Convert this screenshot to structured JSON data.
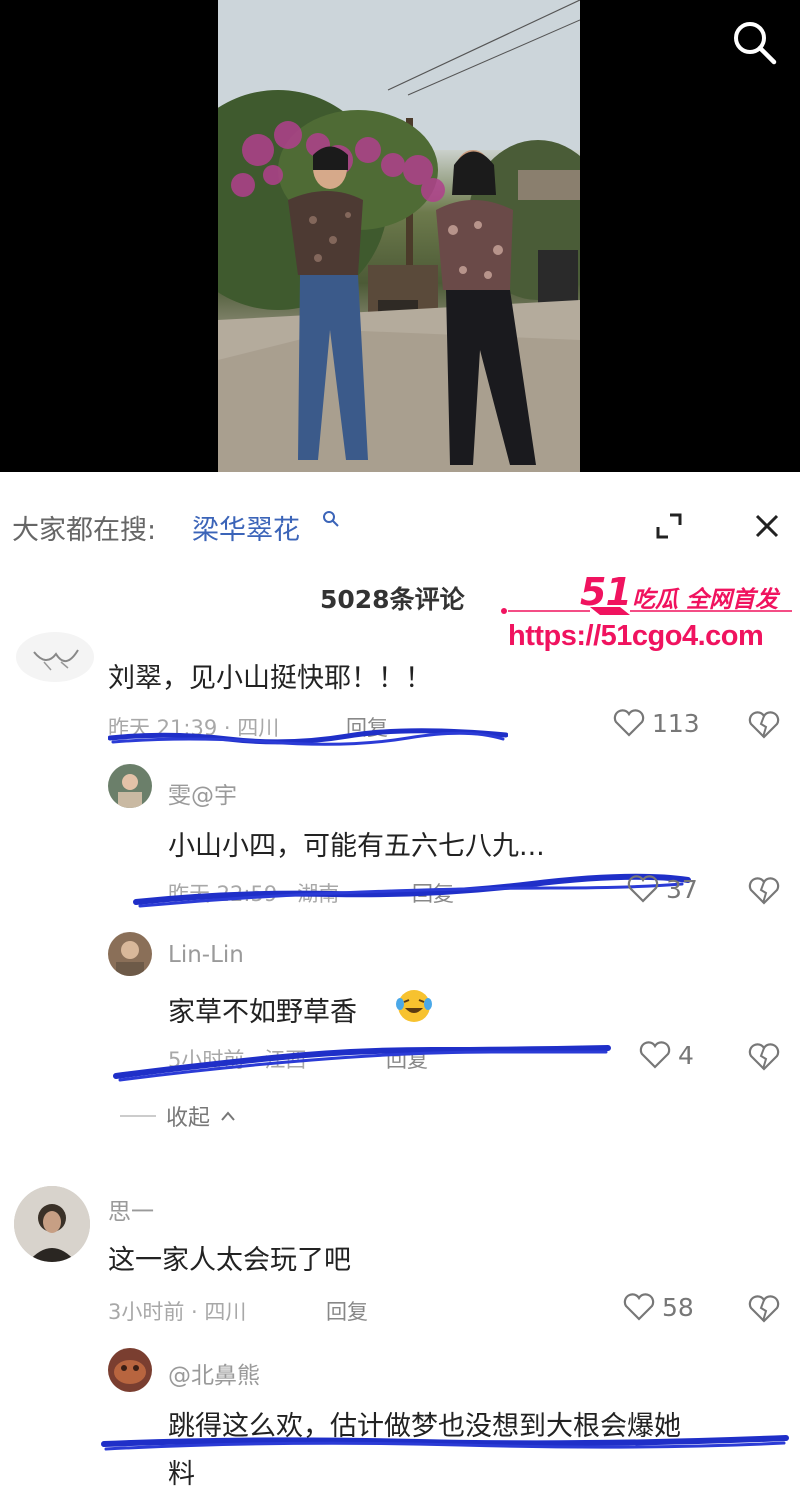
{
  "search": {
    "label": "大家都在搜:",
    "term": "梁华翠花"
  },
  "comments_header": {
    "count_text": "5028条评论"
  },
  "watermark": {
    "brand": "51",
    "tagline": "吃瓜 全网首发",
    "url": "https://51cgo4.com"
  },
  "comments": [
    {
      "text": "刘翠，见小山挺快耶！！！",
      "meta": "昨天 21:39 · 四川",
      "reply_label": "回复",
      "likes": "113",
      "replies": [
        {
          "username": "雯@宇",
          "text": "小山小四，可能有五六七八九...",
          "meta": "昨天 22:59 · 湖南",
          "reply_label": "回复",
          "likes": "37"
        },
        {
          "username": "Lin-Lin",
          "text": "家草不如野草香",
          "meta": "5小时前 · 江西",
          "reply_label": "回复",
          "likes": "4"
        }
      ],
      "collapse_label": "收起"
    },
    {
      "username": "思一",
      "text": "这一家人太会玩了吧",
      "meta": "3小时前 · 四川",
      "reply_label": "回复",
      "likes": "58",
      "replies": [
        {
          "username": "@北鼻熊",
          "text": "跳得这么欢，估计做梦也没想到大根会爆她",
          "text_cont": "料"
        }
      ]
    }
  ],
  "colors": {
    "accent_link": "#3b64b8",
    "watermark": "#f0135f",
    "scribble": "#1f2fc8"
  },
  "icons": [
    "search-icon",
    "expand-icon",
    "close-icon",
    "heart-icon",
    "broken-heart-icon",
    "chevron-up-icon",
    "laughing-emoji-icon"
  ]
}
